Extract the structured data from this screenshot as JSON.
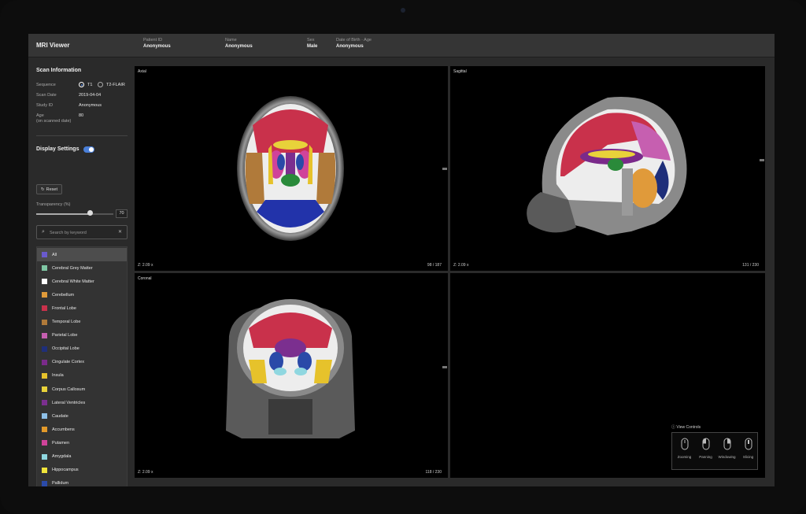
{
  "app": {
    "title": "MRI Viewer"
  },
  "patient": {
    "patient_id_label": "Patient ID",
    "patient_id": "Anonymous",
    "name_label": "Name",
    "name": "Anonymous",
    "sex_label": "Sex",
    "sex": "Male",
    "dob_label": "Date of Birth · Age",
    "dob": "Anonymous"
  },
  "scan_info": {
    "title": "Scan Information",
    "sequence_label": "Sequence",
    "sequence_options": [
      "T1",
      "T2-FLAIR"
    ],
    "sequence_selected": "T1",
    "scan_date_label": "Scan Date",
    "scan_date": "2019-04-04",
    "study_id_label": "Study ID",
    "study_id": "Anonymous",
    "age_label": "Age",
    "age_sub": "(on scanned date)",
    "age": "80"
  },
  "display_settings": {
    "title": "Display Settings",
    "enabled": true,
    "reset_label": "Reset",
    "transparency_label": "Transparency (%)",
    "transparency_value": "70",
    "transparency_fraction": 0.7,
    "search_placeholder": "Search by keyword"
  },
  "regions": [
    {
      "label": "All",
      "color": "#6a5acd",
      "selected": true
    },
    {
      "label": "Cerebral Grey Matter",
      "color": "#7fc6a4"
    },
    {
      "label": "Cerebral White Matter",
      "color": "#ffffff"
    },
    {
      "label": "Cerebellum",
      "color": "#e09a3a"
    },
    {
      "label": "Frontal Lobe",
      "color": "#c9314b"
    },
    {
      "label": "Temporal Lobe",
      "color": "#b07a3a"
    },
    {
      "label": "Parietal Lobe",
      "color": "#c65fb0"
    },
    {
      "label": "Occipital Lobe",
      "color": "#1f2f7a"
    },
    {
      "label": "Cingulate Cortex",
      "color": "#7a2a8a"
    },
    {
      "label": "Insula",
      "color": "#e6c22b"
    },
    {
      "label": "Corpus Callosum",
      "color": "#e8d23a"
    },
    {
      "label": "Lateral Ventricles",
      "color": "#7b2f8f"
    },
    {
      "label": "Caudate",
      "color": "#8ec0e8"
    },
    {
      "label": "Accumbens",
      "color": "#e39a2a"
    },
    {
      "label": "Putamen",
      "color": "#d0439a"
    },
    {
      "label": "Amygdala",
      "color": "#8fd7e0"
    },
    {
      "label": "Hippocampus",
      "color": "#f1e53b"
    },
    {
      "label": "Pallidum",
      "color": "#2a4aa8"
    }
  ],
  "views": {
    "axial": {
      "title": "Axial",
      "zoom": "Z: 2.09 x",
      "slice": "98 / 187"
    },
    "sagittal": {
      "title": "Sagittal",
      "zoom": "Z: 2.09 x",
      "slice": "131 / 230"
    },
    "coronal": {
      "title": "Coronal",
      "zoom": "Z: 2.09 x",
      "slice": "118 / 230"
    }
  },
  "view_controls": {
    "title": "View Controls",
    "items": [
      "Zooming",
      "Panning",
      "Windowing",
      "Slicing"
    ]
  },
  "colors": {
    "accent": "#4a7fd8",
    "background": "#2a2a2a",
    "viewer": "#000000"
  }
}
